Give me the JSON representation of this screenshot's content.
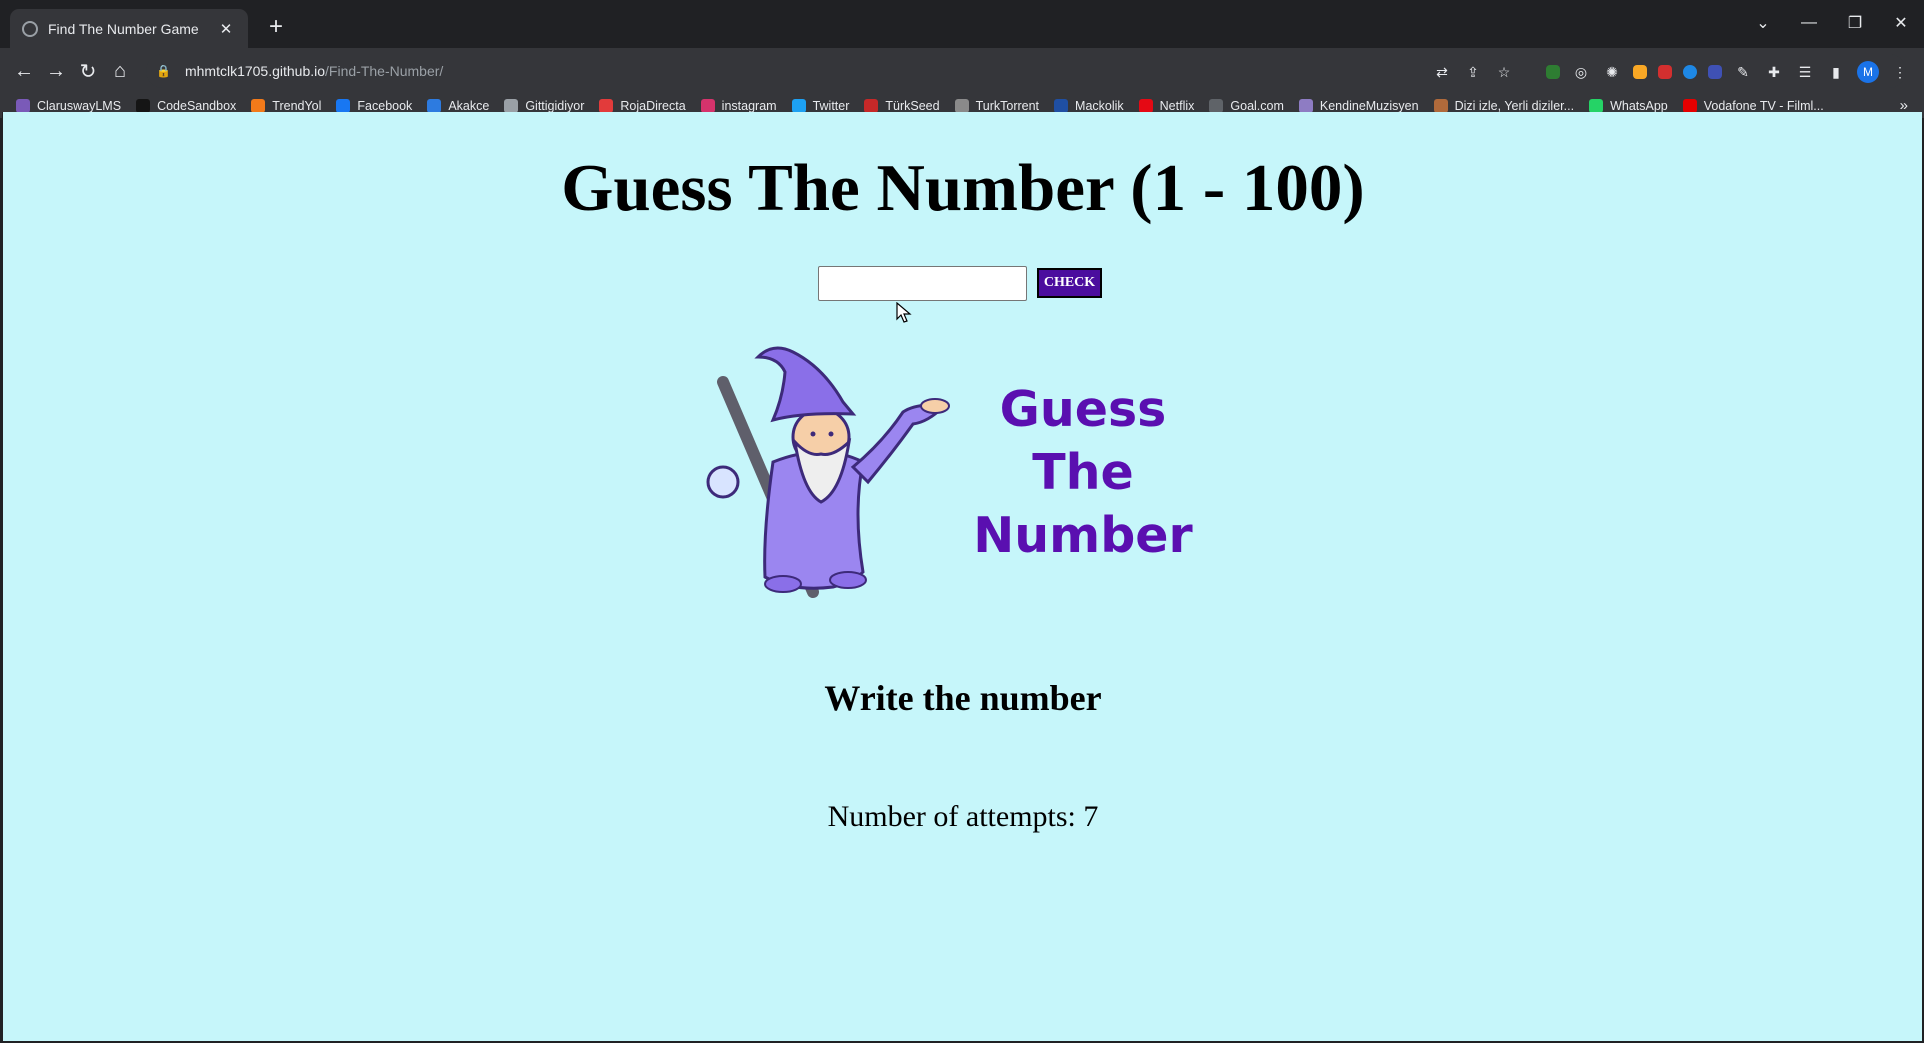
{
  "browser": {
    "tab_title": "Find The Number Game",
    "tab_close": "✕",
    "new_tab": "+",
    "window_controls": {
      "tab_search": "⌄",
      "minimize": "—",
      "restore": "❐",
      "close": "✕"
    },
    "nav": {
      "back": "←",
      "forward": "→",
      "reload": "↻",
      "home": "⌂"
    },
    "url_host": "mhmtclk1705.github.io",
    "url_path": "/Find-The-Number/",
    "profile_initial": "M",
    "bookmarks_more": "»",
    "bookmarks": [
      {
        "label": "ClaruswayLMS",
        "color": "#7a5ab8"
      },
      {
        "label": "CodeSandbox",
        "color": "#151515"
      },
      {
        "label": "TrendYol",
        "color": "#f27a1a"
      },
      {
        "label": "Facebook",
        "color": "#1877f2"
      },
      {
        "label": "Akakce",
        "color": "#2d7be0"
      },
      {
        "label": "Gittigidiyor",
        "color": "#9aa0a6"
      },
      {
        "label": "RojaDirecta",
        "color": "#e23b3b"
      },
      {
        "label": "instagram",
        "color": "#d6336c"
      },
      {
        "label": "Twitter",
        "color": "#1da1f2"
      },
      {
        "label": "TürkSeed",
        "color": "#c62828"
      },
      {
        "label": "TurkTorrent",
        "color": "#8a8a8a"
      },
      {
        "label": "Mackolik",
        "color": "#1f4fa3"
      },
      {
        "label": "Netflix",
        "color": "#e50914"
      },
      {
        "label": "Goal.com",
        "color": "#5f6368"
      },
      {
        "label": "KendineMuzisyen",
        "color": "#8e7cc3"
      },
      {
        "label": "Dizi izle, Yerli diziler...",
        "color": "#b06a3b"
      },
      {
        "label": "WhatsApp",
        "color": "#25d366"
      },
      {
        "label": "Vodafone TV - Filml...",
        "color": "#e60000"
      }
    ]
  },
  "page": {
    "heading": "Guess The Number (1 - 100)",
    "input": {
      "value": "",
      "placeholder": ""
    },
    "check_label": "CHECK",
    "logo_lines": [
      "Guess",
      "The",
      "Number"
    ],
    "message": "Write the number",
    "attempts": "Number of attempts: 7"
  },
  "colors": {
    "page_background": "#c6f6fa",
    "button_background": "#4b0d9e",
    "logo_text": "#5a0fb0",
    "wizard_robe": "#9b86f0"
  }
}
